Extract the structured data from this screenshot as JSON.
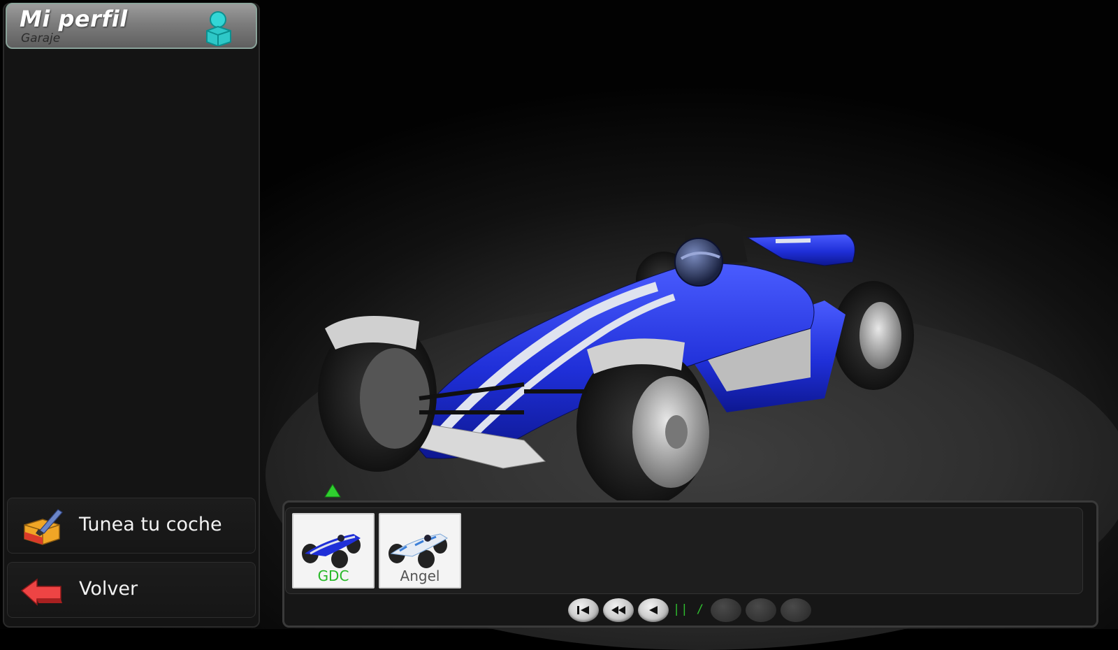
{
  "header": {
    "title": "Mi perfil",
    "subtitle": "Garaje",
    "icon": "user-profile-icon"
  },
  "sidebar": {
    "buttons": [
      {
        "label": "Tunea tu coche",
        "icon": "paint-brush-box-icon"
      },
      {
        "label": "Volver",
        "icon": "back-arrow-icon"
      }
    ]
  },
  "garage": {
    "selected_car_color": "#1f2fd8",
    "cars": [
      {
        "label": "GDC",
        "selected": true,
        "label_color": "#26b826"
      },
      {
        "label": "Angel",
        "selected": false,
        "label_color": "#555555"
      }
    ],
    "pager": {
      "indicator": "|| / ||",
      "buttons": [
        "first-page-icon",
        "previous-fast-icon",
        "previous-icon",
        "next-icon",
        "next-fast-icon",
        "last-page-icon"
      ]
    }
  },
  "colors": {
    "accent_green": "#2fbf2f",
    "car_blue": "#1f2fd8",
    "panel_bg": "#141414"
  }
}
